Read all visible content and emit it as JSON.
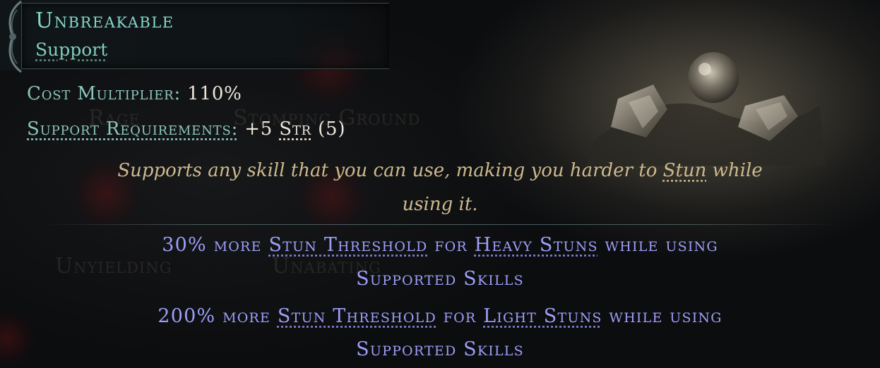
{
  "background": {
    "labels": [
      {
        "name": "bg-label-rage",
        "text": "Rage"
      },
      {
        "name": "bg-label-stomping-ground",
        "text": "Stomping Ground"
      },
      {
        "name": "bg-label-unyielding",
        "text": "Unyielding"
      },
      {
        "name": "bg-label-unabating",
        "text": "Unabating"
      }
    ]
  },
  "gem": {
    "name": "Unbreakable",
    "type": "Support",
    "cost_label": "Cost Multiplier:",
    "cost_value": "110%",
    "req_label": "Support Requirements:",
    "req_value_prefix": "+5",
    "req_attribute": "Str",
    "req_value_suffix": "(5)",
    "description_part1": "Supports any skill that you can use, making you harder to",
    "description_keyword": "Stun",
    "description_part2": "while",
    "description_line2": "using it.",
    "mods": [
      {
        "value": "30% more",
        "keyword1": "Stun Threshold",
        "mid": "for",
        "keyword2": "Heavy Stuns",
        "tail": "while using",
        "line2": "Supported Skills"
      },
      {
        "value": "200% more",
        "keyword1": "Stun Threshold",
        "mid": "for",
        "keyword2": "Light Stuns",
        "tail": "while using",
        "line2": "Supported Skills"
      }
    ]
  },
  "colors": {
    "gem_name": "#84d6ca",
    "label": "#8cc7bd",
    "value": "#ece6da",
    "description": "#cdb98c",
    "mod": "#9e9ef7"
  }
}
